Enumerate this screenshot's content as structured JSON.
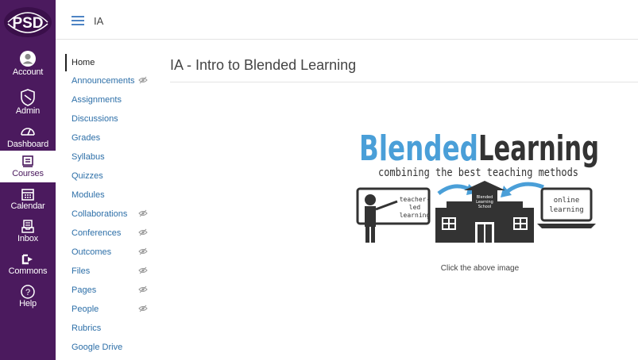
{
  "global_nav": {
    "logo_text": "PSD",
    "items": [
      {
        "label": "Account",
        "icon": "account-icon"
      },
      {
        "label": "Admin",
        "icon": "admin-icon"
      },
      {
        "label": "Dashboard",
        "icon": "dashboard-icon"
      },
      {
        "label": "Courses",
        "icon": "courses-icon"
      },
      {
        "label": "Calendar",
        "icon": "calendar-icon"
      },
      {
        "label": "Inbox",
        "icon": "inbox-icon"
      },
      {
        "label": "Commons",
        "icon": "commons-icon"
      },
      {
        "label": "Help",
        "icon": "help-icon"
      }
    ],
    "active": "Courses",
    "colors": {
      "background": "#4b1a5e",
      "active_bg": "#ffffff"
    }
  },
  "top_bar": {
    "breadcrumb": "IA"
  },
  "course_nav": {
    "items": [
      {
        "label": "Home",
        "active": true
      },
      {
        "label": "Announcements",
        "hidden": true
      },
      {
        "label": "Assignments"
      },
      {
        "label": "Discussions"
      },
      {
        "label": "Grades"
      },
      {
        "label": "Syllabus"
      },
      {
        "label": "Quizzes"
      },
      {
        "label": "Modules"
      },
      {
        "label": "Collaborations",
        "hidden": true
      },
      {
        "label": "Conferences",
        "hidden": true
      },
      {
        "label": "Outcomes",
        "hidden": true
      },
      {
        "label": "Files",
        "hidden": true
      },
      {
        "label": "Pages",
        "hidden": true
      },
      {
        "label": "People",
        "hidden": true
      },
      {
        "label": "Rubrics"
      },
      {
        "label": "Google Drive"
      }
    ],
    "link_color": "#2d6fa8"
  },
  "main": {
    "title": "IA - Intro to Blended Learning",
    "graphic": {
      "word_blended": "Blended",
      "word_learning": "Learning",
      "tagline": "combining the best teaching methods",
      "teacher_label": [
        "teacher-",
        "led",
        "learning"
      ],
      "school_label": [
        "Blended",
        "Learning",
        "School"
      ],
      "online_label": [
        "online",
        "learning"
      ],
      "colors": {
        "blue": "#4a9fd8",
        "dark": "#333333"
      }
    },
    "caption": "Click the above image"
  }
}
